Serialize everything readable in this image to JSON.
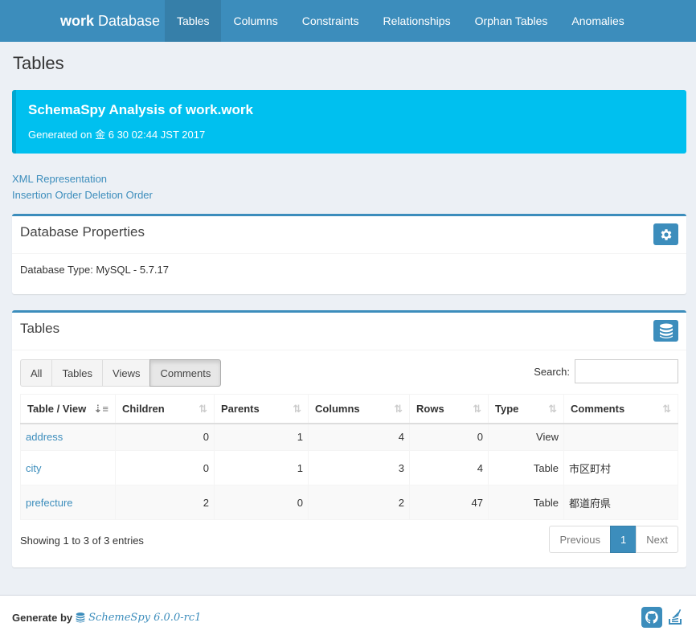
{
  "nav": {
    "brand_bold": "work",
    "brand_rest": "Database",
    "items": [
      "Tables",
      "Columns",
      "Constraints",
      "Relationships",
      "Orphan Tables",
      "Anomalies"
    ]
  },
  "page": {
    "title": "Tables"
  },
  "callout": {
    "title": "SchemaSpy Analysis of work.work",
    "generated": "Generated on 金 6 30 02:44 JST 2017"
  },
  "links": {
    "xml": "XML Representation",
    "insertion": "Insertion Order",
    "deletion": "Deletion Order"
  },
  "db_props": {
    "title": "Database Properties",
    "type_text": "Database Type: MySQL - 5.7.17"
  },
  "tables_box": {
    "title": "Tables",
    "filters": [
      "All",
      "Tables",
      "Views",
      "Comments"
    ],
    "search_label": "Search:",
    "search_value": "",
    "headers": [
      "Table / View",
      "Children",
      "Parents",
      "Columns",
      "Rows",
      "Type",
      "Comments"
    ],
    "rows": [
      {
        "name": "address",
        "children": "0",
        "parents": "1",
        "columns": "4",
        "rows": "0",
        "type": "View",
        "comments": ""
      },
      {
        "name": "city",
        "children": "0",
        "parents": "1",
        "columns": "3",
        "rows": "4",
        "type": "Table",
        "comments": "市区町村"
      },
      {
        "name": "prefecture",
        "children": "2",
        "parents": "0",
        "columns": "2",
        "rows": "47",
        "type": "Table",
        "comments": "都道府県"
      }
    ],
    "showing": "Showing 1 to 3 of 3 entries",
    "pager": {
      "previous": "Previous",
      "current": "1",
      "next": "Next"
    }
  },
  "footer": {
    "generate_by": "Generate by",
    "product": "SchemeSpy 6.0.0-rc1"
  },
  "colors": {
    "primary": "#3c8dbc",
    "callout": "#00c0ef",
    "background": "#ecf0f5"
  }
}
